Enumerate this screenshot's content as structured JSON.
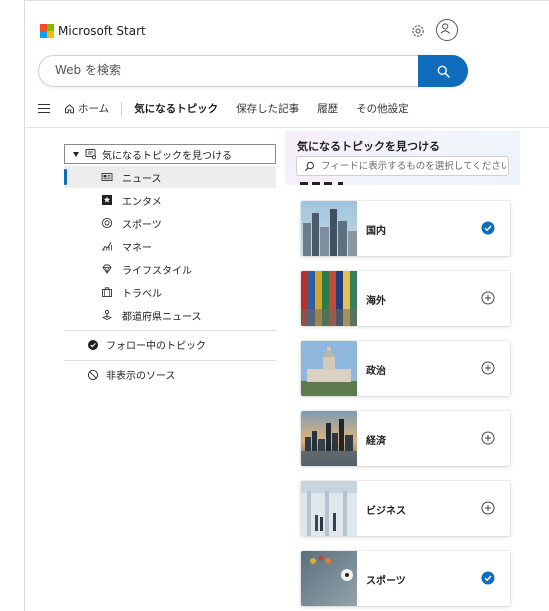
{
  "header": {
    "app_name": "Microsoft Start",
    "logo_colors": [
      "#f25022",
      "#7fba00",
      "#00a4ef",
      "#ffb900"
    ],
    "settings_icon": "gear-icon",
    "profile_icon": "person-icon"
  },
  "search": {
    "placeholder": "Web を検索",
    "button_icon": "search-icon",
    "button_color": "#0f6cbd"
  },
  "nav": {
    "menu_icon": "hamburger-icon",
    "home": "ホーム",
    "items": [
      "気になるトピック",
      "保存した記事",
      "履歴",
      "その他設定"
    ],
    "active": "気になるトピック"
  },
  "sidebar": {
    "root": "気になるトピックを見つける",
    "items": [
      {
        "label": "ニュース",
        "icon": "newspaper-icon",
        "selected": true
      },
      {
        "label": "エンタメ",
        "icon": "star-icon"
      },
      {
        "label": "スポーツ",
        "icon": "ball-icon"
      },
      {
        "label": "マネー",
        "icon": "chart-icon"
      },
      {
        "label": "ライフスタイル",
        "icon": "gem-icon"
      },
      {
        "label": "トラベル",
        "icon": "luggage-icon"
      },
      {
        "label": "都道府県ニュース",
        "icon": "pin-icon"
      }
    ],
    "followed": "フォロー中のトピック",
    "hidden": "非表示のソース"
  },
  "panel": {
    "title": "気になるトピックを見つける",
    "search_placeholder": "フィードに表示するものを選択してください"
  },
  "topics": [
    {
      "label": "国内",
      "followed": true
    },
    {
      "label": "海外",
      "followed": false
    },
    {
      "label": "政治",
      "followed": false
    },
    {
      "label": "経済",
      "followed": false
    },
    {
      "label": "ビジネス",
      "followed": false
    },
    {
      "label": "スポーツ",
      "followed": true
    }
  ]
}
